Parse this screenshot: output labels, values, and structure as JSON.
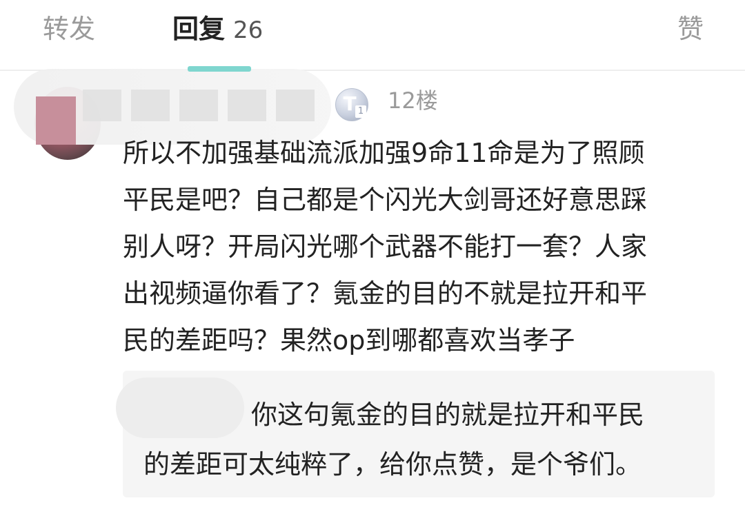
{
  "tabs": {
    "repost_label": "转发",
    "reply_label": "回复",
    "reply_count": "26",
    "like_label": "赞"
  },
  "comment": {
    "level_badge_text": "T",
    "level_badge_sub": "1",
    "floor": "12楼",
    "lines": [
      "所以不加强基础流派加强9命11命是为了照顾",
      "平民是吧？自己都是个闪光大剑哥还好意思踩",
      "别人呀？开局闪光哪个武器不能打一套？人家",
      "出视频逼你看了？氪金的目的不就是拉开和平",
      "民的差距吗？果然op到哪都喜欢当孝子"
    ]
  },
  "reply": {
    "lines": [
      "你这句氪金的目的就是拉开和平民",
      "的差距可太纯粹了，给你点赞，是个爷们。"
    ]
  },
  "colors": {
    "active_tab": "#222222",
    "inactive_tab": "#9a9a9a",
    "reply_background": "#f5f5f5",
    "divider": "#eeeeee"
  }
}
